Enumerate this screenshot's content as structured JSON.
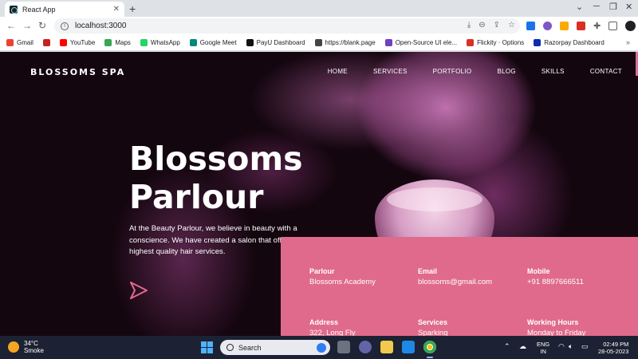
{
  "browser": {
    "tab_title": "React App",
    "tab_close": "✕",
    "new_tab": "+",
    "url": "localhost:3000",
    "bookmarks": [
      {
        "label": "Gmail",
        "color": "#ea4335"
      },
      {
        "label": "",
        "color": "#c5221f"
      },
      {
        "label": "YouTube",
        "color": "#ff0000"
      },
      {
        "label": "Maps",
        "color": "#34a853"
      },
      {
        "label": "WhatsApp",
        "color": "#25d366"
      },
      {
        "label": "Google Meet",
        "color": "#00897b"
      },
      {
        "label": "PayU Dashboard",
        "color": "#111111"
      },
      {
        "label": "https://blank.page",
        "color": "#444444"
      },
      {
        "label": "Open-Source UI ele...",
        "color": "#6f42c1"
      },
      {
        "label": "Flickity · Options",
        "color": "#d93025"
      },
      {
        "label": "Razorpay Dashboard",
        "color": "#0c2bb5"
      }
    ],
    "bookmarks_more": "»"
  },
  "site": {
    "logo": "BLOSSOMS SPA",
    "nav": [
      "HOME",
      "SERVICES",
      "PORTFOLIO",
      "BLOG",
      "SKILLS",
      "CONTACT"
    ],
    "hero_title_line1": "Blossoms",
    "hero_title_line2": "Parlour",
    "hero_text": "At the Beauty Parlour, we believe in beauty with a conscience. We have created a salon that offers the highest quality hair services.",
    "info": [
      {
        "label": "Parlour",
        "value": "Blossoms Academy"
      },
      {
        "label": "Email",
        "value": "blossoms@gmail.com"
      },
      {
        "label": "Mobile",
        "value": "+91 8897666511"
      },
      {
        "label": "Address",
        "value": "322, Long Fly"
      },
      {
        "label": "Services",
        "value": "Sparking"
      },
      {
        "label": "Working Hours",
        "value": "Monday to Friday"
      }
    ],
    "accent_color": "#e06a8c"
  },
  "taskbar": {
    "weather_temp": "34°C",
    "weather_desc": "Smoke",
    "search_placeholder": "Search",
    "lang_line1": "ENG",
    "lang_line2": "IN",
    "time": "02:49 PM",
    "date": "28-05-2023"
  }
}
